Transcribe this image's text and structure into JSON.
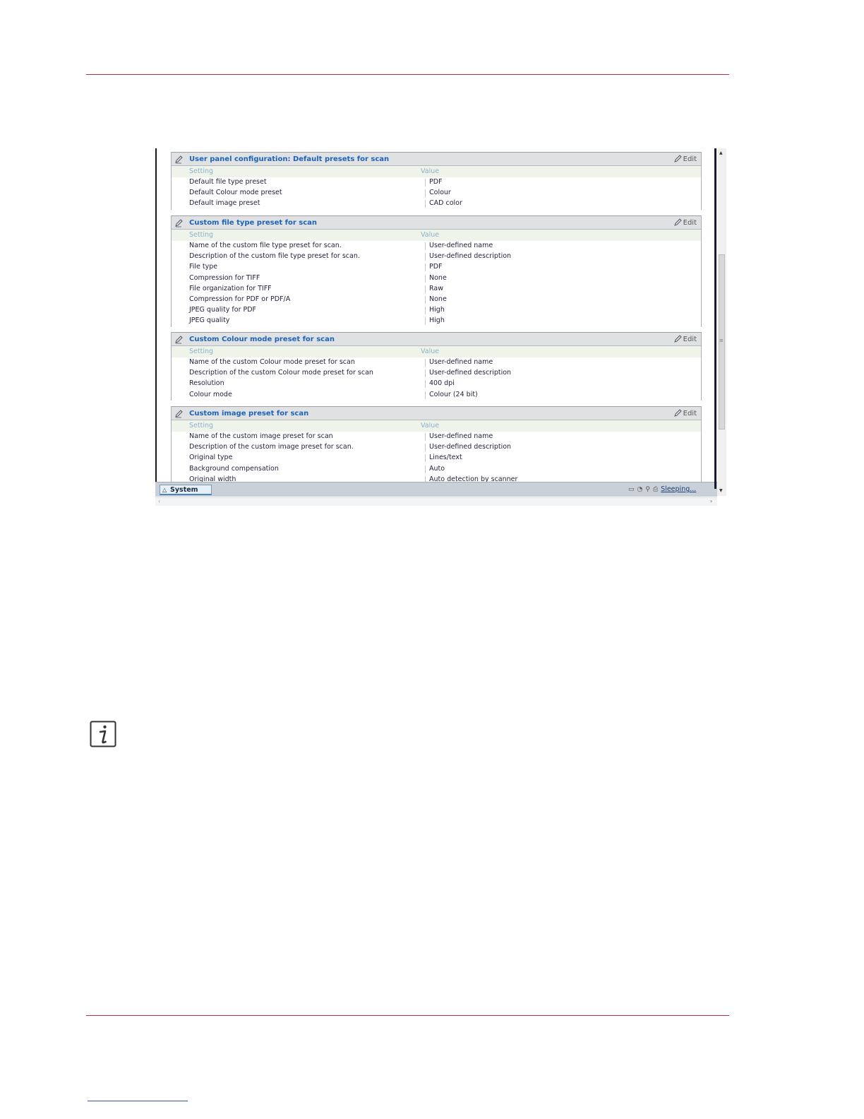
{
  "edit_label": "Edit",
  "column_headers": {
    "setting": "Setting",
    "value": "Value"
  },
  "sections": [
    {
      "title": "User panel configuration: Default presets for scan",
      "rows": [
        {
          "setting": "Default file type preset",
          "value": "PDF"
        },
        {
          "setting": "Default Colour mode preset",
          "value": "Colour"
        },
        {
          "setting": "Default image preset",
          "value": "CAD color"
        }
      ]
    },
    {
      "title": "Custom file type preset for scan",
      "rows": [
        {
          "setting": "Name of the custom file type preset for scan.",
          "value": "User-defined name"
        },
        {
          "setting": "Description of the custom file type preset for scan.",
          "value": "User-defined description"
        },
        {
          "setting": "File type",
          "value": "PDF"
        },
        {
          "setting": "Compression for TIFF",
          "value": "None"
        },
        {
          "setting": "File organization for TIFF",
          "value": "Raw"
        },
        {
          "setting": "Compression for PDF or PDF/A",
          "value": "None"
        },
        {
          "setting": "JPEG quality for PDF",
          "value": "High"
        },
        {
          "setting": "JPEG quality",
          "value": "High"
        }
      ]
    },
    {
      "title": "Custom Colour mode preset for scan",
      "rows": [
        {
          "setting": "Name of the custom Colour mode preset for scan",
          "value": "User-defined name"
        },
        {
          "setting": "Description of the custom Colour mode preset for scan",
          "value": "User-defined description"
        },
        {
          "setting": "Resolution",
          "value": "400 dpi"
        },
        {
          "setting": "Colour mode",
          "value": "Colour (24 bit)"
        }
      ]
    },
    {
      "title": "Custom image preset for scan",
      "rows": [
        {
          "setting": "Name of the custom image preset for scan",
          "value": "User-defined name"
        },
        {
          "setting": "Description of the custom image preset for scan.",
          "value": "User-defined description"
        },
        {
          "setting": "Original type",
          "value": "Lines/text"
        },
        {
          "setting": "Background compensation",
          "value": "Auto"
        },
        {
          "setting": "Original width",
          "value": "Auto detection by scanner"
        }
      ]
    }
  ],
  "statusbar": {
    "system_tab": "System",
    "system_tab_icon": "triangle-up-icon",
    "status_text": "Sleeping..."
  },
  "colors": {
    "section_title": "#1d63b8",
    "header_rule": "#b0304a"
  }
}
